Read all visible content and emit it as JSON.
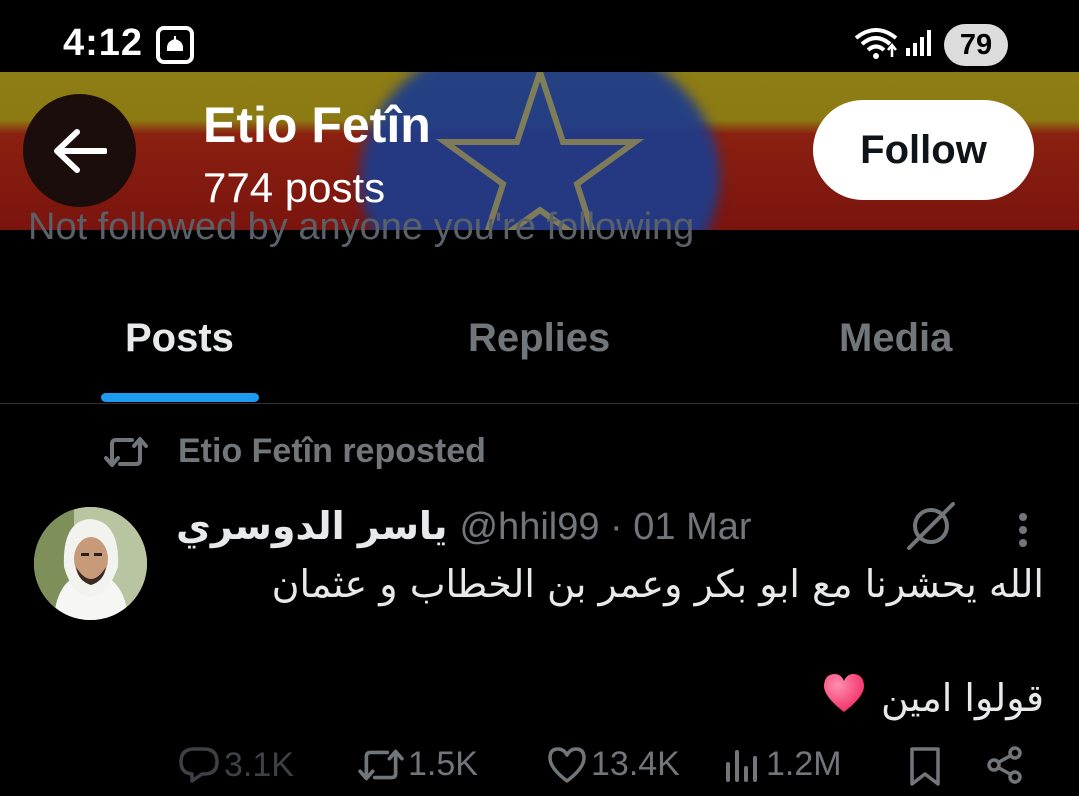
{
  "status_bar": {
    "time": "4:12",
    "battery": "79"
  },
  "header": {
    "name": "Etio Fetîn",
    "post_count": "774 posts",
    "follow_label": "Follow",
    "peek_text": "Not followed by anyone you're following"
  },
  "tabs": [
    {
      "label": "Posts",
      "active": true
    },
    {
      "label": "Replies",
      "active": false
    },
    {
      "label": "Media",
      "active": false
    }
  ],
  "post": {
    "repost_label": "Etio Fetîn reposted",
    "author_name": "ياسر الدوسري",
    "author_meta": "@hhil99 · 01 Mar",
    "text_line1": "الله يحشرنا مع ابو بكر وعمر بن الخطاب و عثمان",
    "text_line2": "قولوا امين",
    "stats": {
      "replies": "3.1K",
      "reposts": "1.5K",
      "likes": "13.4K",
      "views": "1.2M"
    }
  },
  "colors": {
    "accent": "#1d9bf0",
    "muted": "#71767b",
    "heart": "#f0245e"
  },
  "icons": [
    "back-arrow-icon",
    "repost-icon",
    "grok-icon",
    "more-icon",
    "reply-icon",
    "like-icon",
    "views-icon",
    "bookmark-icon",
    "share-icon"
  ]
}
